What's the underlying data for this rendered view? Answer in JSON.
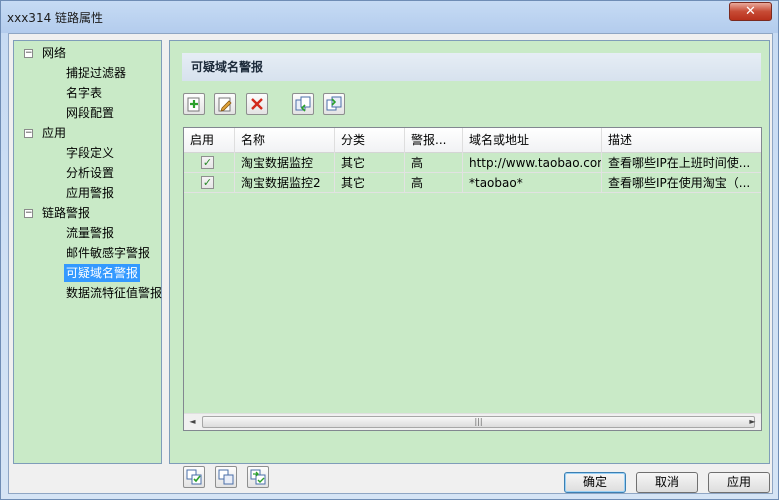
{
  "window": {
    "title": "xxx314 链路属性",
    "close_glyph": "✕"
  },
  "tree": {
    "groups": [
      {
        "label": "网络",
        "toggle": "−",
        "children": [
          "捕捉过滤器",
          "名字表",
          "网段配置"
        ]
      },
      {
        "label": "应用",
        "toggle": "−",
        "children": [
          "字段定义",
          "分析设置",
          "应用警报"
        ]
      },
      {
        "label": "链路警报",
        "toggle": "−",
        "children": [
          "流量警报",
          "邮件敏感字警报",
          "可疑域名警报",
          "数据流特征值警报"
        ]
      }
    ],
    "selected": "可疑域名警报"
  },
  "panel": {
    "title": "可疑域名警报",
    "toolbar": [
      "add-icon",
      "edit-icon",
      "delete-icon",
      "import-icon",
      "export-icon"
    ]
  },
  "table": {
    "columns": [
      "启用",
      "名称",
      "分类",
      "警报...",
      "域名或地址",
      "描述"
    ],
    "rows": [
      {
        "enabled": true,
        "name": "淘宝数据监控",
        "category": "其它",
        "level": "高",
        "domain": "http://www.taobao.com",
        "desc": "查看哪些IP在上班时间使..."
      },
      {
        "enabled": true,
        "name": "淘宝数据监控2",
        "category": "其它",
        "level": "高",
        "domain": "*taobao*",
        "desc": "查看哪些IP在使用淘宝（..."
      }
    ],
    "check_glyph": "✓",
    "scroll_left": "◄",
    "scroll_right": "►",
    "scroll_grip": "|||"
  },
  "bottom_icons": [
    "select-all-icon",
    "copy-icon",
    "invert-select-icon"
  ],
  "buttons": {
    "ok": "确定",
    "cancel": "取消",
    "apply": "应用"
  },
  "colors": {
    "panel_bg": "#c9eac7",
    "selection": "#3399ff",
    "delete": "#d22a1a",
    "accent_green": "#2aa02a"
  }
}
